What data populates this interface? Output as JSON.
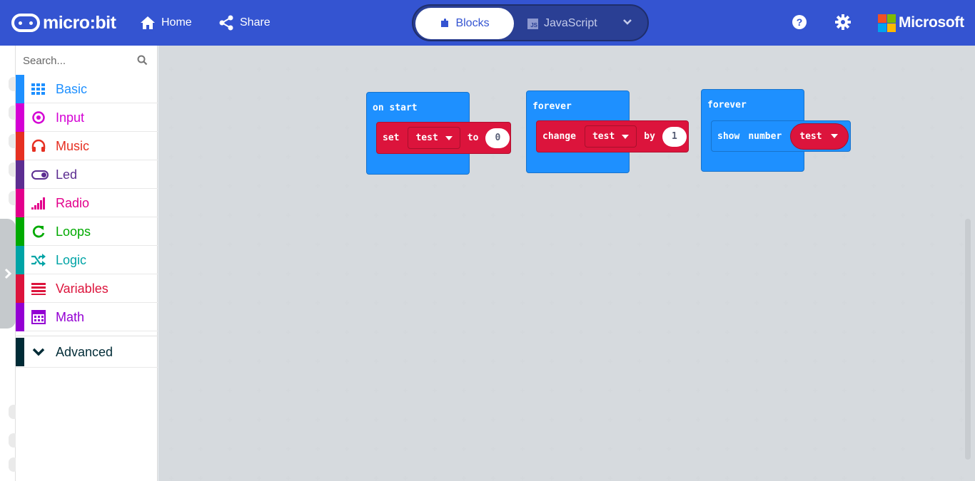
{
  "header": {
    "logo_text": "micro:bit",
    "home_label": "Home",
    "share_label": "Share",
    "blocks_tab": "Blocks",
    "javascript_tab": "JavaScript",
    "brand_text": "Microsoft",
    "colors": {
      "header_bg": "#3454d1"
    }
  },
  "toolbox": {
    "search_placeholder": "Search...",
    "categories": [
      {
        "label": "Basic",
        "icon": "grid-icon",
        "color": "#1e90ff"
      },
      {
        "label": "Input",
        "icon": "target-icon",
        "color": "#d400d4"
      },
      {
        "label": "Music",
        "icon": "headphones-icon",
        "color": "#e63022"
      },
      {
        "label": "Led",
        "icon": "toggle-icon",
        "color": "#5c2d91"
      },
      {
        "label": "Radio",
        "icon": "signal-bars-icon",
        "color": "#e3008c"
      },
      {
        "label": "Loops",
        "icon": "refresh-icon",
        "color": "#00aa00"
      },
      {
        "label": "Logic",
        "icon": "shuffle-icon",
        "color": "#00a4a6"
      },
      {
        "label": "Variables",
        "icon": "list-icon",
        "color": "#dc143c"
      },
      {
        "label": "Math",
        "icon": "calculator-icon",
        "color": "#9400d3"
      }
    ],
    "advanced": {
      "label": "Advanced",
      "icon": "chevron-down-icon",
      "color": "#002b36"
    }
  },
  "workspace": {
    "block_on_start": {
      "title": "on start",
      "set_kw": "set",
      "var": "test",
      "to_kw": "to",
      "value": "0"
    },
    "block_forever_1": {
      "title": "forever",
      "change_kw": "change",
      "var": "test",
      "by_kw": "by",
      "value": "1"
    },
    "block_forever_2": {
      "title": "forever",
      "show_kw": "show",
      "number_kw": "number",
      "var": "test"
    }
  }
}
